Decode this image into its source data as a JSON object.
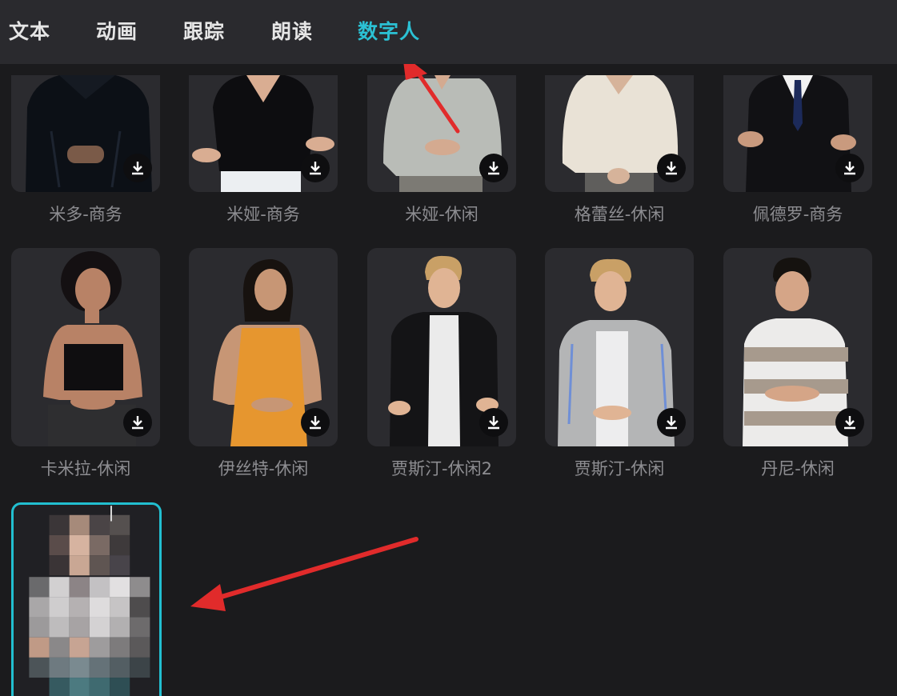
{
  "tabs": [
    {
      "label": "文本",
      "active": false
    },
    {
      "label": "动画",
      "active": false
    },
    {
      "label": "跟踪",
      "active": false
    },
    {
      "label": "朗读",
      "active": false
    },
    {
      "label": "数字人",
      "active": true
    }
  ],
  "accent_color": "#2bc1d4",
  "annotation_color": "#e12b2b",
  "avatars": [
    {
      "name": "米多-商务",
      "icon": "download-icon"
    },
    {
      "name": "米娅-商务",
      "icon": "download-icon"
    },
    {
      "name": "米娅-休闲",
      "icon": "download-icon"
    },
    {
      "name": "格蕾丝-休闲",
      "icon": "download-icon"
    },
    {
      "name": "佩德罗-商务",
      "icon": "download-icon"
    },
    {
      "name": "卡米拉-休闲",
      "icon": "download-icon"
    },
    {
      "name": "伊丝特-休闲",
      "icon": "download-icon"
    },
    {
      "name": "贾斯汀-休闲2",
      "icon": "download-icon"
    },
    {
      "name": "贾斯汀-休闲",
      "icon": "download-icon"
    },
    {
      "name": "丹尼-休闲",
      "icon": "download-icon"
    }
  ],
  "custom_avatar": {
    "state": "selected",
    "content": "pixelated-portrait"
  }
}
